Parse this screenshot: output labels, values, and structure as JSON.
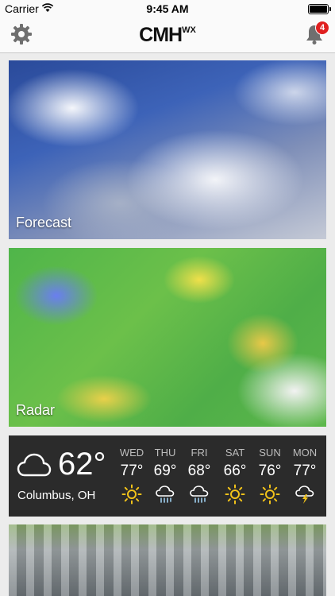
{
  "status_bar": {
    "carrier": "Carrier",
    "time": "9:45 AM"
  },
  "nav": {
    "logo_main": "CMH",
    "logo_sup": "WX",
    "notification_count": "4"
  },
  "cards": {
    "forecast_label": "Forecast",
    "radar_label": "Radar"
  },
  "current": {
    "temp": "62°",
    "location": "Columbus, OH",
    "icon": "cloud-icon"
  },
  "forecast": [
    {
      "day": "WED",
      "temp": "77°",
      "icon": "sun-icon"
    },
    {
      "day": "THU",
      "temp": "69°",
      "icon": "rain-icon"
    },
    {
      "day": "FRI",
      "temp": "68°",
      "icon": "rain-icon"
    },
    {
      "day": "SAT",
      "temp": "66°",
      "icon": "sun-icon"
    },
    {
      "day": "SUN",
      "temp": "76°",
      "icon": "sun-icon"
    },
    {
      "day": "MON",
      "temp": "77°",
      "icon": "thunderstorm-icon"
    }
  ],
  "colors": {
    "sun": "#f2c31a",
    "badge": "#e02020",
    "panel": "#2b2b2b"
  }
}
